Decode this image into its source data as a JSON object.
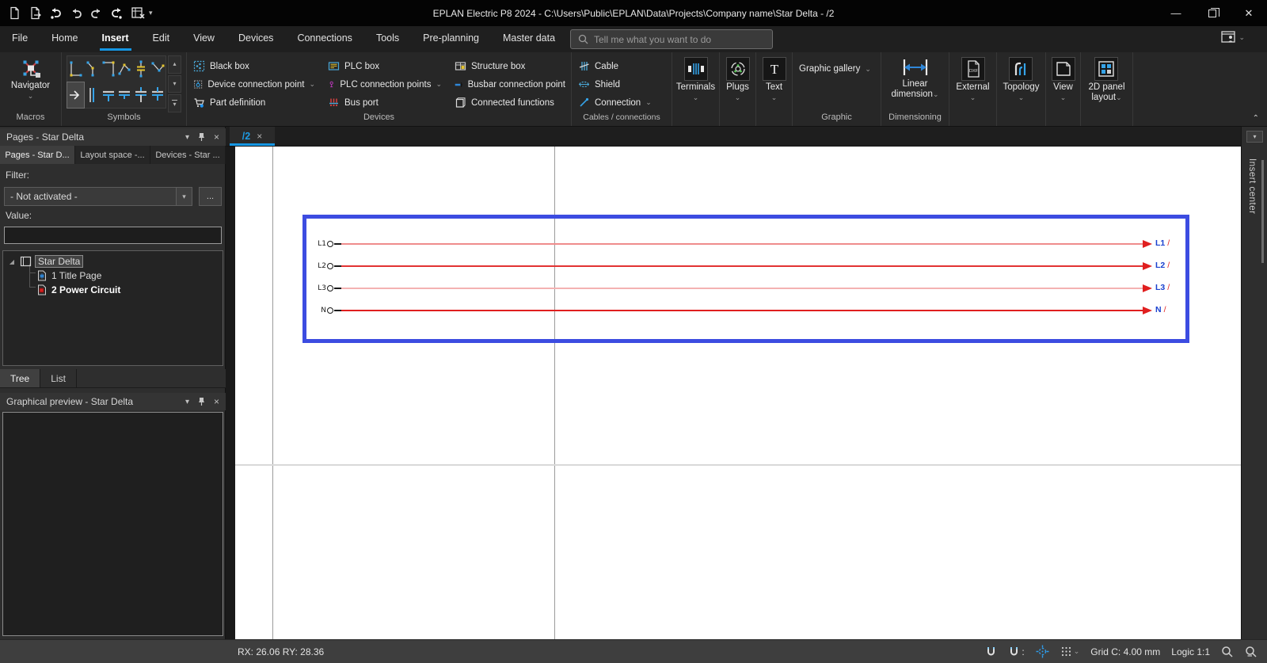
{
  "titlebar": {
    "title": "EPLAN Electric P8 2024 - C:\\Users\\Public\\EPLAN\\Data\\Projects\\Company name\\Star Delta - /2"
  },
  "menu": {
    "items": [
      "File",
      "Home",
      "Insert",
      "Edit",
      "View",
      "Devices",
      "Connections",
      "Tools",
      "Pre-planning",
      "Master data"
    ],
    "active_item": "Insert",
    "search_placeholder": "Tell me what you want to do"
  },
  "ribbon": {
    "macros": {
      "caption": "Macros",
      "navigator_label": "Navigator"
    },
    "symbols": {
      "caption": "Symbols"
    },
    "devices": {
      "caption": "Devices",
      "col1": [
        "Black box",
        "Device connection point",
        "Part definition"
      ],
      "col2": [
        "PLC box",
        "PLC connection points",
        "Bus port"
      ],
      "col3": [
        "Structure box",
        "Busbar connection point",
        "Connected functions"
      ]
    },
    "cables": {
      "caption": "Cables / connections",
      "items": [
        "Cable",
        "Shield",
        "Connection"
      ]
    },
    "terminals_label": "Terminals",
    "plugs_label": "Plugs",
    "text_label": "Text",
    "graphic": {
      "caption": "Graphic",
      "gallery_label": "Graphic gallery"
    },
    "dimensioning": {
      "caption": "Dimensioning",
      "linear1": "Linear",
      "linear2": "dimension"
    },
    "external_label": "External",
    "topology_label": "Topology",
    "view_label": "View",
    "panel1": "2D panel",
    "panel2": "layout"
  },
  "pages_panel": {
    "title": "Pages - Star Delta",
    "tabs": [
      "Pages - Star D...",
      "Layout space -...",
      "Devices - Star ..."
    ],
    "filter_label": "Filter:",
    "filter_value": "- Not activated -",
    "more_button": "...",
    "value_label": "Value:",
    "value_text": "",
    "tree": {
      "root": "Star Delta",
      "items": [
        "1 Title Page",
        "2 Power Circuit"
      ]
    },
    "bottom_tabs": [
      "Tree",
      "List"
    ]
  },
  "preview_panel": {
    "title": "Graphical preview - Star Delta"
  },
  "editor": {
    "tab_label": "/2",
    "insert_center_label": "Insert center",
    "end_slash": "/",
    "wires": [
      {
        "start": "L1",
        "end": "L1",
        "color": "#ef8c8c"
      },
      {
        "start": "L2",
        "end": "L2",
        "color": "#e23333"
      },
      {
        "start": "L3",
        "end": "L3",
        "color": "#f4b2b2"
      },
      {
        "start": "N",
        "end": "N",
        "color": "#e01f1f"
      }
    ]
  },
  "status": {
    "coords": "RX: 26.06 RY: 28.36",
    "grid": "Grid C: 4.00 mm",
    "logic": "Logic 1:1"
  },
  "colors": {
    "accent": "#1596e3",
    "selection_blue": "#3c4ce1",
    "wire_red": "#e01f1f",
    "wire_label_blue": "#1a41cf"
  }
}
